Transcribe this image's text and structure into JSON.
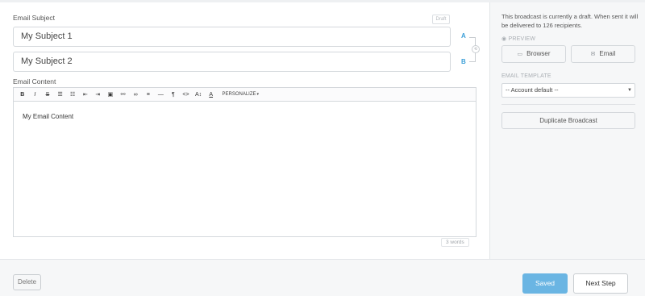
{
  "form": {
    "subject_label": "Email Subject",
    "draft_badge": "Draft",
    "subject_a": "My Subject 1",
    "subject_b": "My Subject 2",
    "ab_a": "A",
    "ab_b": "B",
    "ab_toggle": "⟲",
    "content_label": "Email Content",
    "content_text": "My Email Content",
    "word_count": "3 words"
  },
  "toolbar": {
    "bold": "B",
    "italic": "I",
    "strike": "S",
    "unordered_list": "☰",
    "ordered_list": "☷",
    "outdent": "⇤",
    "indent": "⇥",
    "image": "▣",
    "link": "⚯",
    "unlink": "∞",
    "align": "≡",
    "rule": "—",
    "paragraph": "¶",
    "code": "<>",
    "text_size": "A↕",
    "text_color": "A",
    "personalize": "PERSONALIZE"
  },
  "sidebar": {
    "status_text": "This broadcast is currently a draft. When sent it will be delivered to 126 recipients.",
    "preview_caption": "PREVIEW",
    "browser_label": "Browser",
    "email_label": "Email",
    "template_caption": "EMAIL TEMPLATE",
    "template_value": "-- Account default --",
    "duplicate_label": "Duplicate Broadcast"
  },
  "footer": {
    "delete_label": "Delete",
    "saved_label": "Saved",
    "next_label": "Next Step"
  },
  "colors": {
    "accent": "#3b9fd8",
    "saved_button": "#6ab5e3",
    "sidebar_bg": "#f6f7f8"
  },
  "icons": {
    "preview": "eye-icon",
    "browser": "browser-window-icon",
    "email": "envelope-icon",
    "dropdown": "chevron-down-icon",
    "personalize_caret": "caret-down-icon"
  }
}
